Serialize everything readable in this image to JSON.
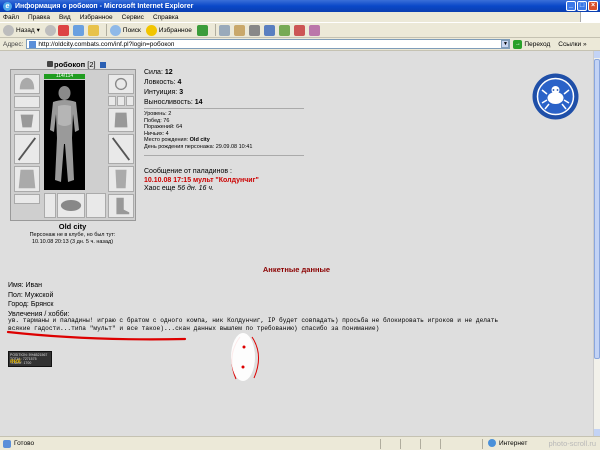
{
  "window": {
    "title": "Информация о робокоп - Microsoft Internet Explorer",
    "buttons": {
      "minimize": "_",
      "maximize": "□",
      "close": "×"
    }
  },
  "menu": {
    "items": [
      "Файл",
      "Правка",
      "Вид",
      "Избранное",
      "Сервис",
      "Справка"
    ]
  },
  "toolbar": {
    "back_label": "Назад",
    "search_label": "Поиск",
    "favorites_label": "Избранное"
  },
  "address": {
    "label": "Адрес:",
    "url": "http://oldcity.combats.com/inf.pl?login=робокоп",
    "go_label": "Переход",
    "links_label": "Ссылки",
    "links_arrow": "»"
  },
  "character": {
    "name": "робокоп",
    "level": "[2]",
    "hp": "114/114",
    "stats": [
      {
        "label": "Сила:",
        "value": "12"
      },
      {
        "label": "Ловкость:",
        "value": "4"
      },
      {
        "label": "Интуиция:",
        "value": "3"
      },
      {
        "label": "Выносливость:",
        "value": "14"
      }
    ],
    "extra": {
      "level_line": "Уровень: 2",
      "wins_line": "Побед: 76",
      "losses_line": "Поражений: 64",
      "draws_line": "Ничьих: 4",
      "birthplace_label": "Место рождения:",
      "birthplace_value": "Old city",
      "birthday_line": "День рождения персонажа: 29.09.08 10:41"
    },
    "city": "Old city",
    "club_note_1": "Персонаж не в клубе, но был тут:",
    "club_note_2": "10.10.08 20:13 (3 дн. 5 ч. назад)"
  },
  "paladin_message": {
    "header": "Сообщение от паладинов :",
    "line": "10.10.08 17:15 мульт \"Колдунчиг\"",
    "chaos_prefix": "Хаос еще ",
    "chaos_time": "56 дн. 16 ч."
  },
  "profile": {
    "title": "Анкетные данные",
    "name_line": "Имя: Иван",
    "gender_line": "Пол: Мужской",
    "city_line": "Город: Брянск",
    "hobby_label": "Увлечения / хобби:",
    "hobby_text_1": "ув. тарманы и паладины! играю с братом с одного компа, ник Колдунчиг, IP будет совпадать) просьба не блокировать игроков и не делать",
    "hobby_text_2": "всякие гадости...типа \"мульт\" и все такое)...скан данных вышлем по требованию) спасибо за понимание)"
  },
  "badge": {
    "top_line_1": "POSITION: 5%6521567",
    "top_line_2": "TOTAL: 7271575",
    "top_line_3": "TODAY: 1700",
    "brand": "moi"
  },
  "status": {
    "done": "Готово",
    "zone": "Интернет",
    "watermark": "photo-scroll.ru"
  },
  "colors": {
    "titlebar": "#0a48c8",
    "content_bg": "#dedede",
    "hp_bar": "#1f9c1f",
    "message_red": "#cc0000",
    "profile_title": "#8b0000",
    "annotation_red": "#dd0000",
    "emblem_blue": "#1f4fa8"
  }
}
